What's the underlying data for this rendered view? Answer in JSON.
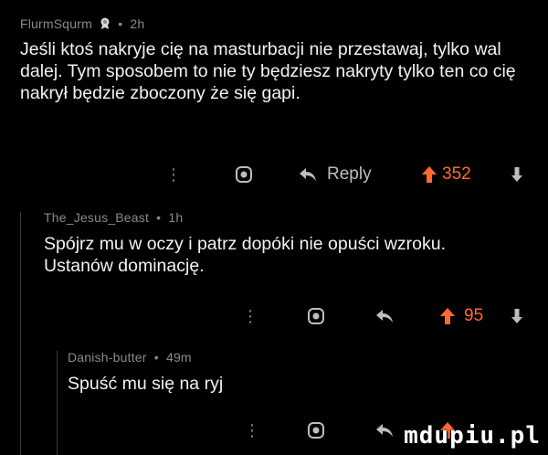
{
  "colors": {
    "background": "#000000",
    "upvote_active": "#ff6a2f",
    "meta": "#8a8a8a",
    "text": "#f2f2f2",
    "icon": "#bdbdbd"
  },
  "comments": [
    {
      "author": "FlurmSqurm",
      "has_award": true,
      "award_icon": "award-badge-icon",
      "time": "2h",
      "body": "Jeśli ktoś nakryje cię na masturbacji nie przestawaj, tylko wal dalej. Tym sposobem to nie ty będziesz nakryty tylko ten co cię nakrył będzie zboczony że się gapi.",
      "reply_label": "Reply",
      "score": "352"
    },
    {
      "author": "The_Jesus_Beast",
      "time": "1h",
      "body": "Spójrz mu w oczy i patrz dopóki nie opuści wzroku. Ustanów dominację.",
      "score": "95"
    },
    {
      "author": "Danish-butter",
      "time": "49m",
      "body": "Spuść mu się na ryj"
    }
  ],
  "separator": "•",
  "more_dots": "⋮",
  "watermark": "mdupiu.pl"
}
